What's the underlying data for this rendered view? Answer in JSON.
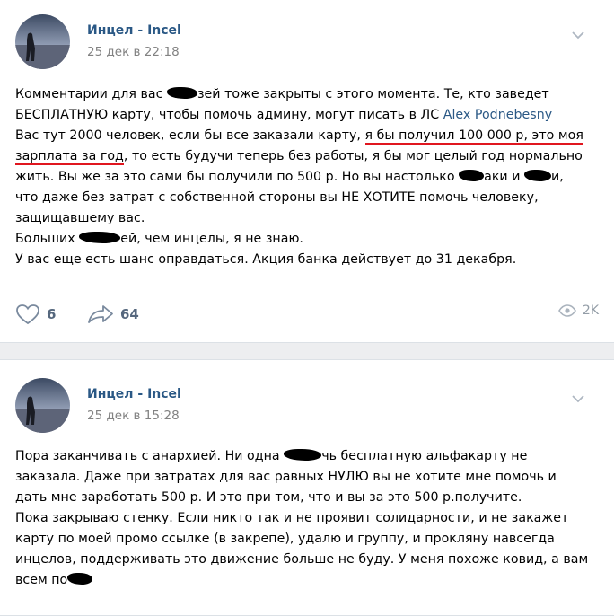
{
  "posts": [
    {
      "author": "Инцел - Incel",
      "date": "25 дек в 22:18",
      "lines": {
        "l1a": "Комментарии для вас ",
        "l1b": "зей тоже закрыты с этого момента. Те, кто заведет",
        "l2a": "БЕСПЛАТНУЮ карту, чтобы помочь админу, могут писать в ЛС ",
        "l2link": "Alex Podnebesny",
        "l3a": "Вас тут 2000 человек, если бы все заказали карту, ",
        "l3u": "я бы получил 100 000 р, это моя",
        "l4u": "зарплата за год",
        "l4b": ", то есть будучи теперь без работы, я бы мог целый год нормально",
        "l5a": "жить. Вы же за это сами бы получили по 500 р. Но вы настолько ",
        "l5b": "аки и ",
        "l5c": "и,",
        "l6": "что даже без затрат с собственной стороны вы НЕ ХОТИТЕ помочь человеку,",
        "l7": "защищавшему вас.",
        "l8a": "Больших ",
        "l8b": "ей, чем инцелы, я не знаю.",
        "l9": "У вас еще есть шанс оправдаться. Акция банка действует до 31 декабря."
      },
      "likes": "6",
      "shares": "64",
      "views": "2K"
    },
    {
      "author": "Инцел - Incel",
      "date": "25 дек в 15:28",
      "lines": {
        "l1a": "Пора заканчивать с анархией. Ни одна ",
        "l1b": "чь бесплатную альфакарту не",
        "l2": "заказала. Даже при затратах для вас равных НУЛЮ вы не хотите мне помочь и",
        "l3": "дать мне заработать 500 р. И это при том, что и вы за это 500 р.получите.",
        "l4": "Пока закрываю стенку. Если никто так и не проявит солидарности, и не закажет",
        "l5": "карту по моей промо ссылке (в закрепе), удалю и группу, и прокляну навсегда",
        "l6": "инцелов, поддерживать это движение больше не буду. У меня похоже ковид, а вам",
        "l7": "всем по"
      }
    }
  ],
  "icons": {
    "like": "heart-icon",
    "share": "share-arrow-icon",
    "views": "eye-icon",
    "more": "chevron-down-icon"
  },
  "colors": {
    "link": "#2a5885",
    "highlight": "#e0161f",
    "background": "#edeef0"
  }
}
